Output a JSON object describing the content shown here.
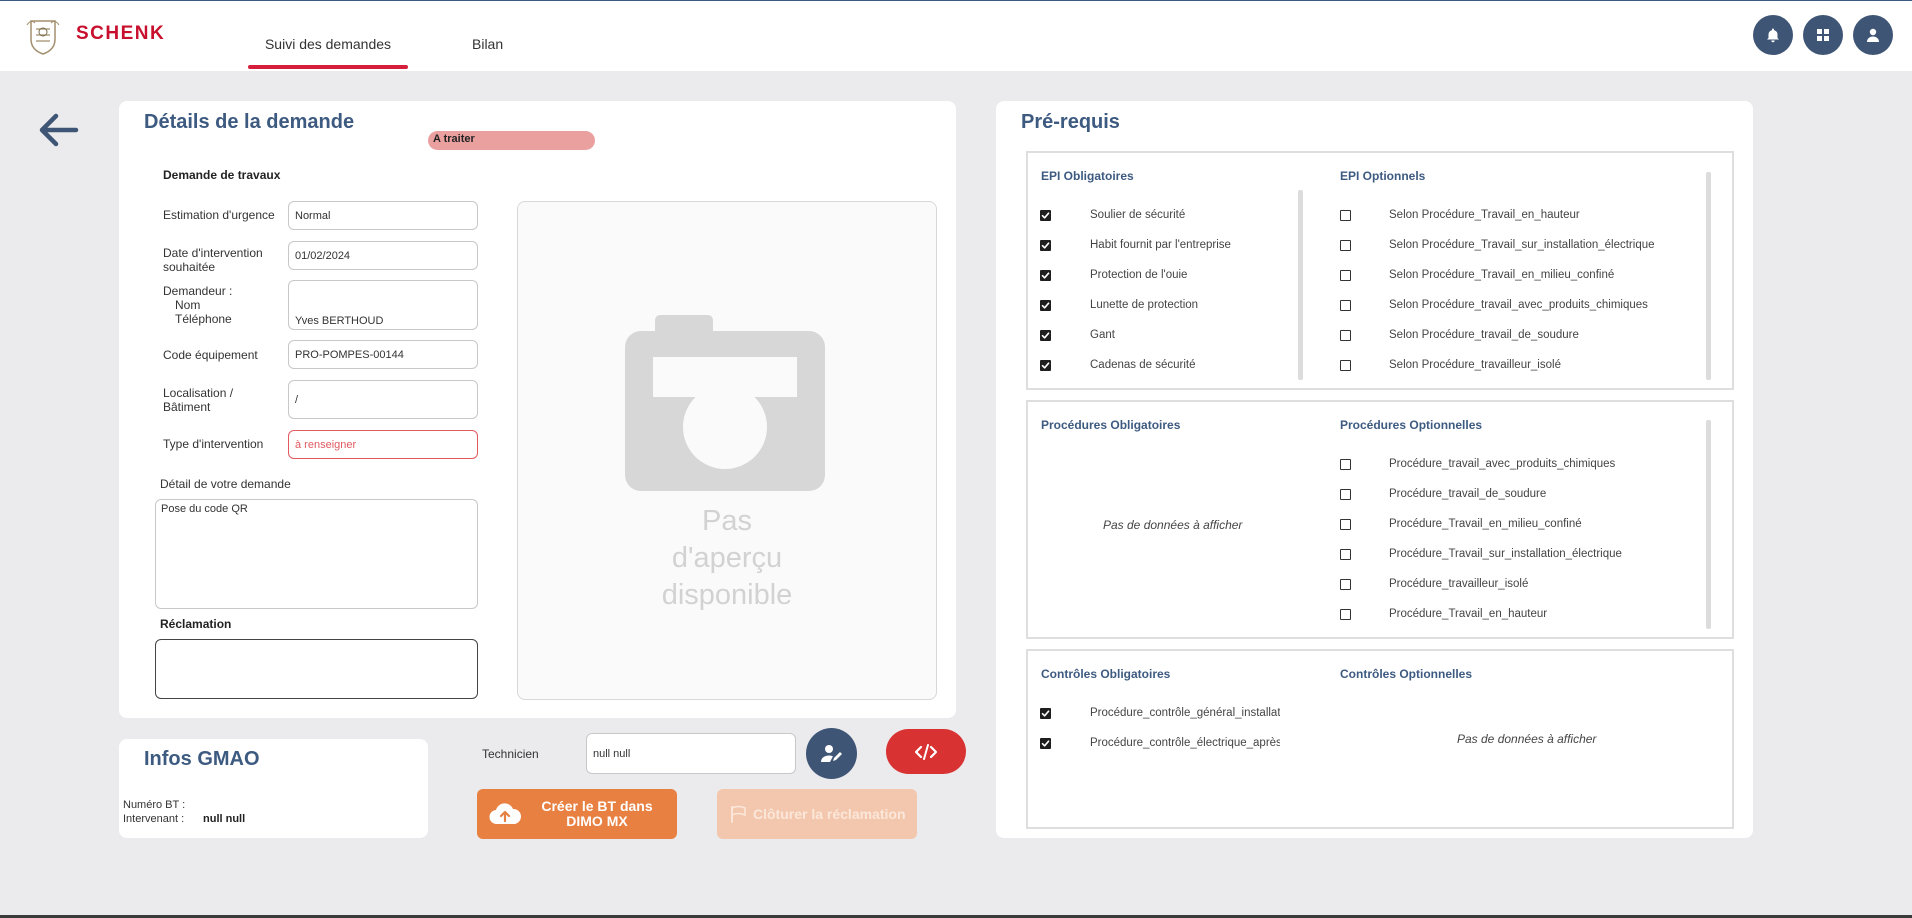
{
  "app": {
    "brand": "SCHENK",
    "brand_color": "#c8102e",
    "accent": "#3d5a80"
  },
  "nav": {
    "tabs": [
      {
        "label": "Suivi des demandes",
        "active": true
      },
      {
        "label": "Bilan",
        "active": false
      }
    ]
  },
  "header_icons": [
    "bell-icon",
    "grid-icon",
    "user-icon"
  ],
  "details": {
    "title": "Détails de la demande",
    "status": "A traiter",
    "section_heading": "Demande de travaux",
    "fields": [
      {
        "label": "Estimation d'urgence",
        "value": "Normal"
      },
      {
        "label": "Date d'intervention souhaitée",
        "value": "01/02/2024"
      },
      {
        "label_lines": [
          "Demandeur :",
          "Nom",
          "Téléphone"
        ],
        "value": "Yves BERTHOUD"
      },
      {
        "label": "Code équipement",
        "value": "PRO-POMPES-00144"
      },
      {
        "label": "Localisation / Bâtiment",
        "value": "/"
      },
      {
        "label": "Type d'intervention",
        "value": "à renseigner"
      }
    ],
    "detail_label": "Détail de votre demande",
    "detail_value": "Pose du code QR",
    "reclamation_label": "Réclamation",
    "reclamation_value": "",
    "photo_placeholder": "Pas d'aperçu disponible"
  },
  "gmao": {
    "title": "Infos GMAO",
    "bt_label": "Numéro BT :",
    "bt_value": "",
    "intervenant_label": "Intervenant :",
    "intervenant_value": "null null"
  },
  "actions": {
    "technicien_label": "Technicien",
    "technicien_value": "null null",
    "create_bt_label": "Créer le BT dans\nDIMO MX",
    "close_label": "Clôturer la réclamation"
  },
  "prerequis": {
    "title": "Pré-requis",
    "epi_obligatoires": {
      "title": "EPI Obligatoires",
      "items": [
        {
          "label": "Soulier de sécurité",
          "checked": true
        },
        {
          "label": "Habit fournit par l'entreprise",
          "checked": true
        },
        {
          "label": "Protection de l'ouie",
          "checked": true
        },
        {
          "label": "Lunette de protection",
          "checked": true
        },
        {
          "label": "Gant",
          "checked": true
        },
        {
          "label": "Cadenas de sécurité",
          "checked": true
        }
      ]
    },
    "epi_optionnels": {
      "title": "EPI Optionnels",
      "items": [
        {
          "label": "Selon Procédure_Travail_en_hauteur",
          "checked": false
        },
        {
          "label": "Selon Procédure_Travail_sur_installation_électrique",
          "checked": false
        },
        {
          "label": "Selon Procédure_Travail_en_milieu_confiné",
          "checked": false
        },
        {
          "label": "Selon Procédure_travail_avec_produits_chimiques",
          "checked": false
        },
        {
          "label": "Selon Procédure_travail_de_soudure",
          "checked": false
        },
        {
          "label": "Selon Procédure_travailleur_isolé",
          "checked": false
        }
      ]
    },
    "procedures_obligatoires": {
      "title": "Procédures Obligatoires",
      "empty": "Pas de données à afficher"
    },
    "procedures_optionnelles": {
      "title": "Procédures Optionnelles",
      "items": [
        {
          "label": "Procédure_travail_avec_produits_chimiques",
          "checked": false
        },
        {
          "label": "Procédure_travail_de_soudure",
          "checked": false
        },
        {
          "label": "Procédure_Travail_en_milieu_confiné",
          "checked": false
        },
        {
          "label": "Procédure_Travail_sur_installation_électrique",
          "checked": false
        },
        {
          "label": "Procédure_travailleur_isolé",
          "checked": false
        },
        {
          "label": "Procédure_Travail_en_hauteur",
          "checked": false
        }
      ]
    },
    "controles_obligatoires": {
      "title": "Contrôles Obligatoires",
      "items": [
        {
          "label": "Procédure_contrôle_général_installat",
          "checked": true
        },
        {
          "label": "Procédure_contrôle_électrique_après",
          "checked": true
        }
      ]
    },
    "controles_optionnels": {
      "title": "Contrôles Optionnelles",
      "empty": "Pas de données à afficher"
    }
  }
}
